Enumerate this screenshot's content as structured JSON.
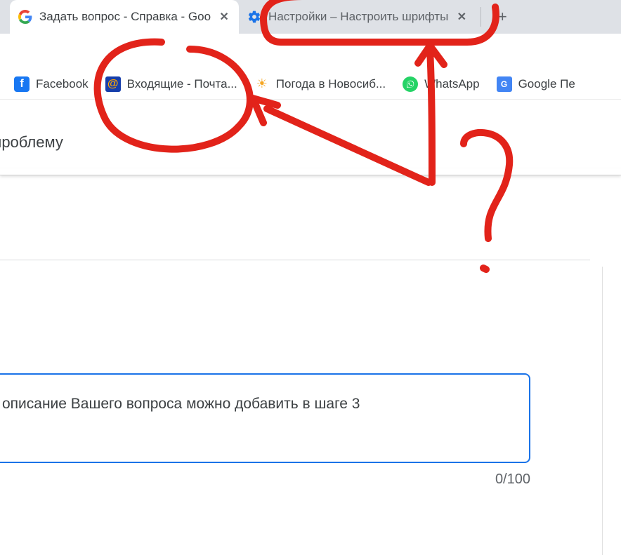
{
  "tabs": [
    {
      "title": "Задать вопрос - Справка - Goo",
      "icon": "google-g-icon"
    },
    {
      "title": "Настройки – Настроить шрифты",
      "icon": "settings-gear-icon"
    }
  ],
  "newtab_label": "+",
  "bookmarks": [
    {
      "icon": "facebook-icon",
      "label": "Facebook"
    },
    {
      "icon": "mailru-icon",
      "label": "Входящие - Почта..."
    },
    {
      "icon": "weather-icon",
      "label": "Погода в Новосиб..."
    },
    {
      "icon": "whatsapp-icon",
      "label": "WhatsApp"
    },
    {
      "icon": "gtranslate-icon",
      "label": "Google Пе"
    }
  ],
  "crumb": "ишите проблему",
  "input_placeholder": "описание Вашего вопроса можно добавить в шаге 3",
  "counter": "0/100"
}
